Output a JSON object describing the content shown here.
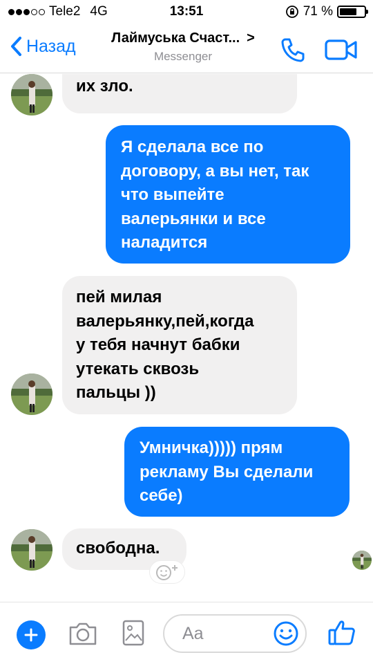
{
  "status_bar": {
    "carrier": "Tele2",
    "network": "4G",
    "time": "13:51",
    "battery": "71 %",
    "battery_level": 0.71,
    "signal_bars": 3,
    "signal_total": 5
  },
  "header": {
    "back_label": "Назад",
    "title": "Лаймуська Счаст...",
    "title_chevron": ">",
    "subtitle": "Messenger",
    "icons": [
      "phone-icon",
      "video-camera-icon"
    ]
  },
  "messages": [
    {
      "direction": "in",
      "lines": [
        "их зло."
      ],
      "avatar": true
    },
    {
      "direction": "out",
      "lines": [
        "Я сделала все по",
        "договору, а вы нет, так",
        "что выпейте",
        "валерьянки и все",
        "наладится"
      ]
    },
    {
      "direction": "in",
      "lines": [
        "пей милая",
        "валерьянку,пей,когда",
        "у тебя начнут бабки",
        "утекать сквозь",
        "пальцы ))"
      ],
      "avatar": true
    },
    {
      "direction": "out",
      "lines": [
        "Умничка))))) прям",
        "рекламу Вы сделали",
        "себе)"
      ]
    },
    {
      "direction": "in",
      "lines": [
        "свободна."
      ],
      "avatar": true
    }
  ],
  "composer": {
    "placeholder": "Aa",
    "icons": [
      "plus-icon",
      "camera-icon",
      "gallery-icon",
      "emoji-icon",
      "thumbs-up-icon"
    ]
  },
  "colors": {
    "accent": "#0a7cff",
    "incoming_bubble": "#f1f0f0",
    "subtitle": "#8e8e93"
  }
}
